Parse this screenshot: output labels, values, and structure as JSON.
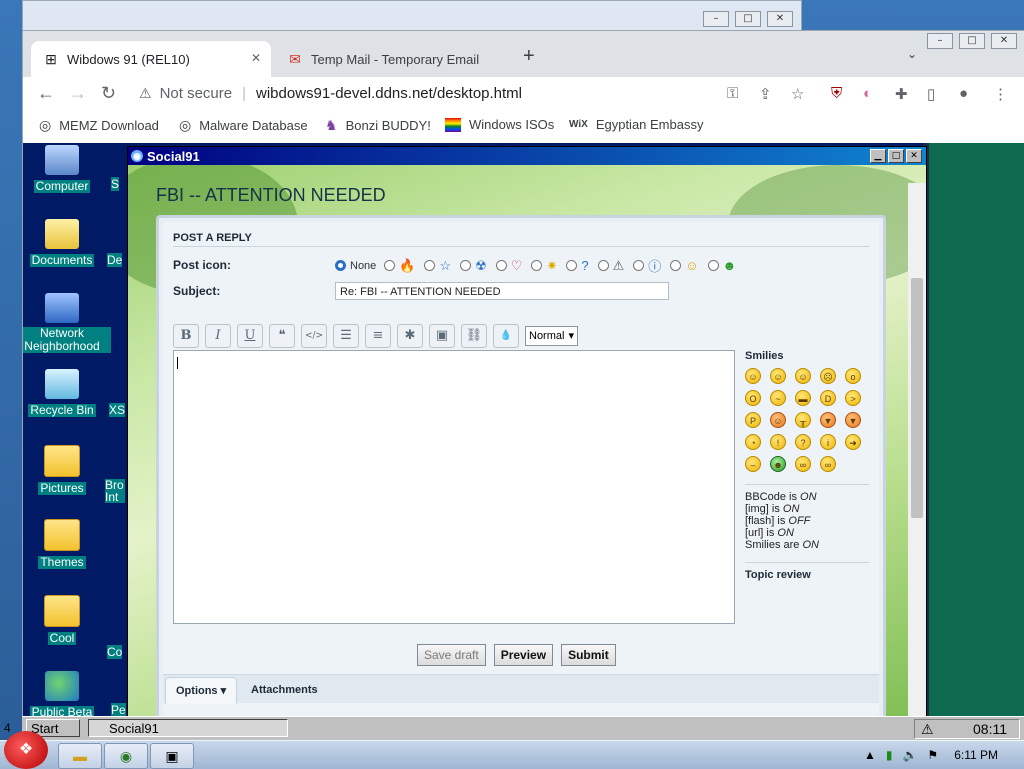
{
  "host": {
    "back_window_ctrls": [
      "–",
      "□",
      "✕"
    ],
    "browser_ctrls": [
      "–",
      "□",
      "✕"
    ]
  },
  "browser": {
    "tabs": [
      {
        "title": "Wibdows 91 (REL10)",
        "icon": "windows-logo-icon"
      },
      {
        "title": "Temp Mail - Temporary Email",
        "icon": "gmail-icon"
      }
    ],
    "new_tab": "+",
    "tab_dropdown": "⌄",
    "address": {
      "security": "Not secure",
      "url": "wibdows91-devel.ddns.net/desktop.html"
    },
    "bookmarks": [
      {
        "label": "MEMZ Download",
        "icon": "globe-icon"
      },
      {
        "label": "Malware Database",
        "icon": "globe-icon"
      },
      {
        "label": "Bonzi BUDDY!",
        "icon": "bonzi-icon"
      },
      {
        "label": "Windows ISOs",
        "icon": "rainbow-flag-icon"
      },
      {
        "label": "Egyptian Embassy",
        "icon": "wix-icon"
      }
    ],
    "wix": "WiX"
  },
  "desktop": {
    "icons": [
      {
        "label": "Computer",
        "type": "comp"
      },
      {
        "label": "Documents",
        "type": "docs"
      },
      {
        "label": "Network Neighborhood",
        "type": "net"
      },
      {
        "label": "Recycle Bin",
        "type": "bin"
      },
      {
        "label": "Pictures",
        "type": "folder"
      },
      {
        "label": "Themes",
        "type": "folder"
      },
      {
        "label": "Cool",
        "type": "folder"
      },
      {
        "label": "Public Beta",
        "type": "globe"
      }
    ],
    "col2_partial": [
      "S",
      "De",
      "XS",
      "Bro Int",
      "Co",
      "Pe"
    ]
  },
  "social91": {
    "window_title": "Social91",
    "topic_title": "FBI -- ATTENTION NEEDED",
    "panel_heading": "POST A REPLY",
    "post_icon_label": "Post icon:",
    "post_icon_none": "None",
    "subject_label": "Subject:",
    "subject_value": "Re: FBI -- ATTENTION NEEDED",
    "format_buttons": [
      {
        "glyph": "B",
        "name": "bold-button"
      },
      {
        "glyph": "I",
        "name": "italic-button"
      },
      {
        "glyph": "U",
        "name": "underline-button"
      },
      {
        "glyph": "❝",
        "name": "quote-button"
      },
      {
        "glyph": "</>",
        "name": "code-button"
      },
      {
        "glyph": "☰",
        "name": "list-button"
      },
      {
        "glyph": "≡",
        "name": "ordered-list-button"
      },
      {
        "glyph": "✱",
        "name": "list-item-button"
      },
      {
        "glyph": "▣",
        "name": "image-button"
      },
      {
        "glyph": "⛓",
        "name": "link-button"
      },
      {
        "glyph": "💧",
        "name": "color-button"
      }
    ],
    "font_size": "Normal",
    "smilies_heading": "Smilies",
    "bbcode": [
      {
        "text": "BBCode is ",
        "state": "ON"
      },
      {
        "text": "[img] is ",
        "state": "ON"
      },
      {
        "text": "[flash] is ",
        "state": "OFF"
      },
      {
        "text": "[url] is ",
        "state": "ON"
      },
      {
        "text": "Smilies are ",
        "state": "ON"
      }
    ],
    "topic_review": "Topic review",
    "buttons": {
      "save_draft": "Save draft",
      "preview": "Preview",
      "submit": "Submit"
    },
    "options_tab": "Options ▾",
    "attachments_tab": "Attachments"
  },
  "w98_taskbar": {
    "start": "Start",
    "task": "Social91",
    "clock": "08:11",
    "left_num": "4"
  },
  "w7_taskbar": {
    "clock": "6:11 PM"
  }
}
